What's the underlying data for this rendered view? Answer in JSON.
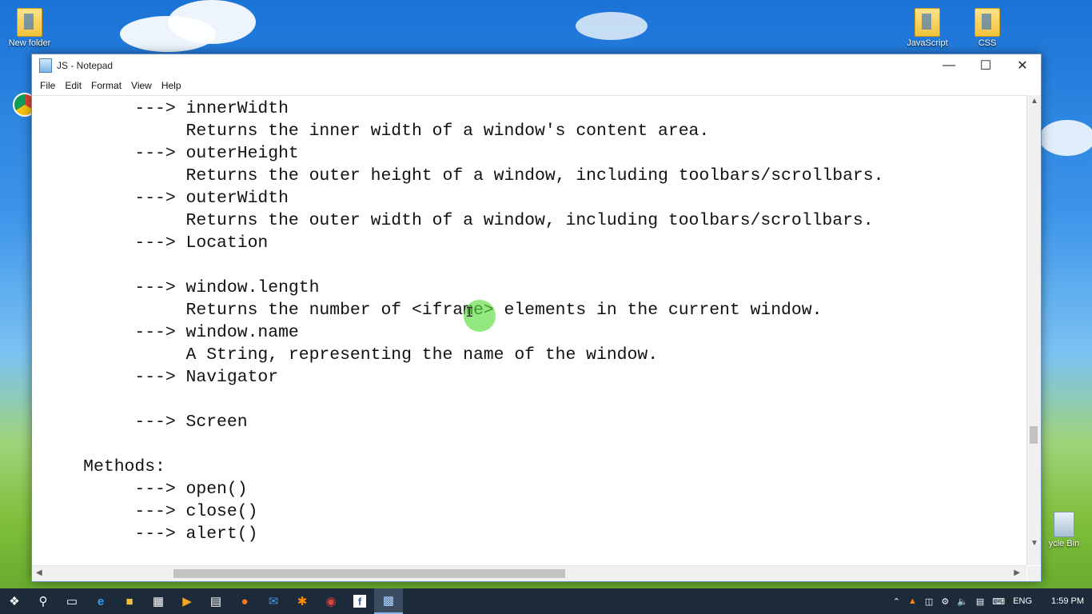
{
  "desktop": {
    "icons": [
      {
        "label": "New folder",
        "icon": "folder-icon"
      },
      {
        "label": "JavaScript",
        "icon": "folder-icon"
      },
      {
        "label": "CSS",
        "icon": "folder-icon"
      },
      {
        "label": "ycle Bin",
        "icon": "recycle-bin-icon"
      }
    ]
  },
  "window": {
    "title": "JS - Notepad",
    "menu": [
      "File",
      "Edit",
      "Format",
      "View",
      "Help"
    ],
    "controls": {
      "minimize": "—",
      "maximize": "☐",
      "close": "✕"
    }
  },
  "editor": {
    "lines": [
      "          ---> innerWidth",
      "               Returns the inner width of a window's content area.",
      "          ---> outerHeight",
      "               Returns the outer height of a window, including toolbars/scrollbars.",
      "          ---> outerWidth",
      "               Returns the outer width of a window, including toolbars/scrollbars.",
      "          ---> Location",
      "",
      "          ---> window.length",
      "               Returns the number of <iframe> elements in the current window.",
      "          ---> window.name",
      "               A String, representing the name of the window.",
      "          ---> Navigator",
      "",
      "          ---> Screen",
      "",
      "     Methods:",
      "          ---> open()",
      "          ---> close()",
      "          ---> alert()"
    ]
  },
  "taskbar": {
    "language": "ENG",
    "time": "1:59 PM",
    "icons": [
      "windows-start-icon",
      "search-icon",
      "task-view-icon",
      "edge-icon",
      "file-explorer-icon",
      "store-icon",
      "media-player-icon",
      "film-icon",
      "firefox-icon",
      "outlook-icon",
      "burst-icon",
      "chrome-icon",
      "facebook-icon",
      "notepad-icon"
    ]
  }
}
